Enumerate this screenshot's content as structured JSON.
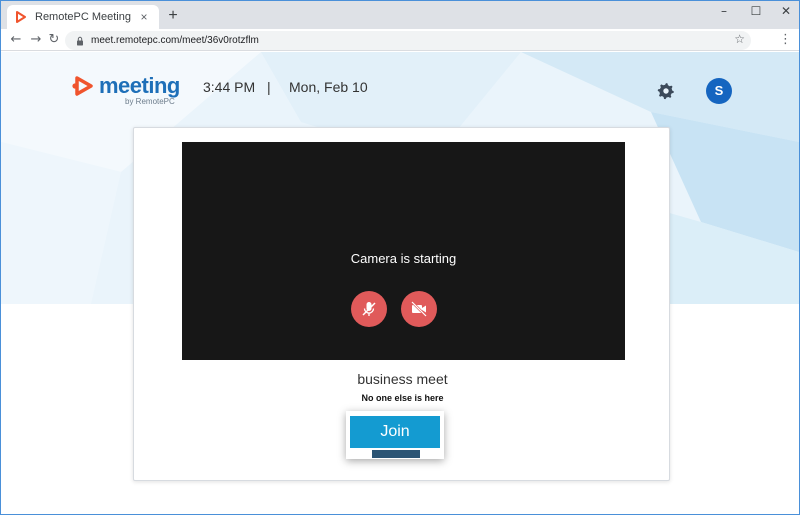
{
  "browser": {
    "tab_title": "RemotePC Meeting",
    "tab_close": "×",
    "new_tab": "+",
    "url": "meet.remotepc.com/meet/36v0rotzflm",
    "window_controls": {
      "minimize": "–",
      "maximize": "☐",
      "close": "✕"
    },
    "nav": {
      "back": "←",
      "forward": "→",
      "reload": "↻"
    },
    "bookmark_star": "☆",
    "menu": "⋮"
  },
  "header": {
    "logo_word": "meeting",
    "logo_sub": "by RemotePC",
    "time": "3:44 PM",
    "separator": "|",
    "date": "Mon, Feb 10",
    "avatar_initial": "S"
  },
  "preview": {
    "status": "Camera is starting"
  },
  "meeting": {
    "name": "business meet",
    "participants_note": "No one else is here",
    "join_label": "Join"
  },
  "colors": {
    "brand_blue": "#1e6fb8",
    "logo_orange": "#f0542d",
    "join_blue": "#149bd1",
    "control_red": "#e05a5a",
    "video_bg": "#171717",
    "avatar_blue": "#1565c0"
  }
}
